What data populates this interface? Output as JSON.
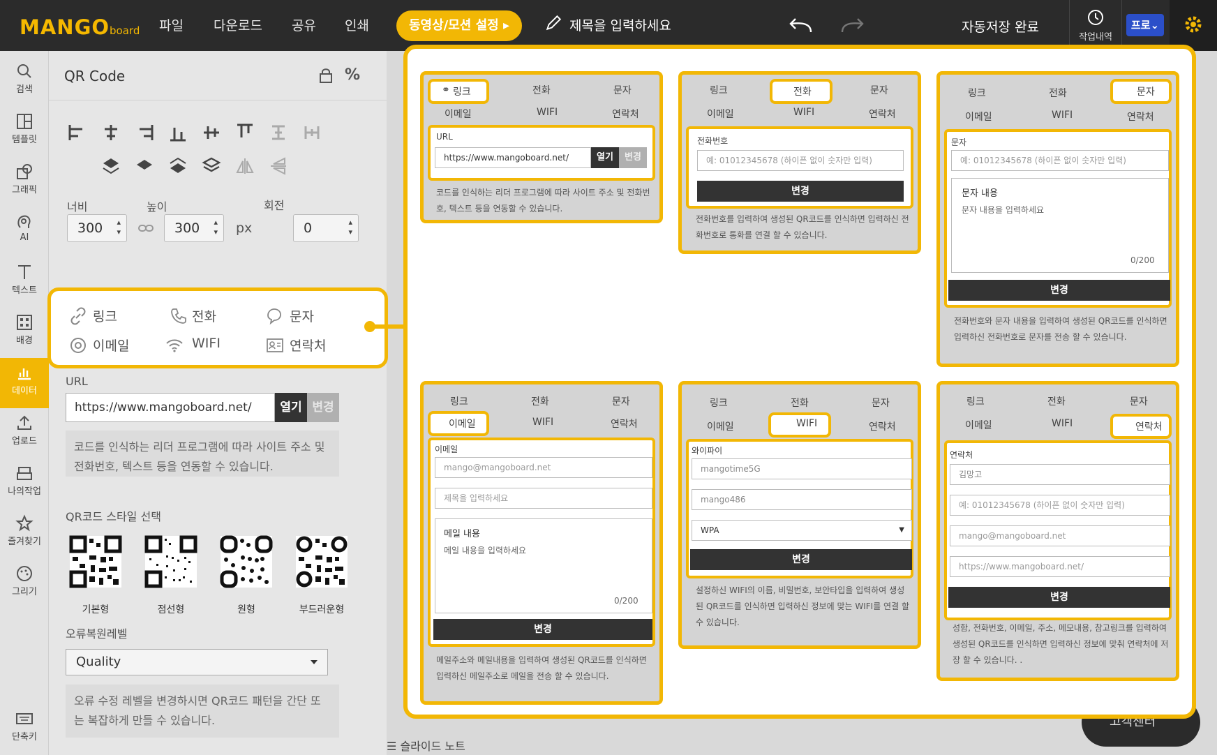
{
  "topbar": {
    "logo": "MANGO",
    "logo_small": "board",
    "menus": [
      "파일",
      "다운로드",
      "공유",
      "인쇄"
    ],
    "motion_button": "동영상/모션 설정 ▸",
    "title_placeholder": "제목을 입력하세요",
    "autosave": "자동저장 완료",
    "history": "작업내역",
    "pro": "프로⌄"
  },
  "iconbar": [
    "검색",
    "템플릿",
    "그래픽",
    "AI",
    "텍스트",
    "배경",
    "데이터",
    "업로드",
    "나의작업",
    "즐겨찾기",
    "그리기",
    "단축키"
  ],
  "panel": {
    "title": "QR Code",
    "width_label": "너비",
    "height_label": "높이",
    "rotate_label": "회전",
    "width": "300",
    "height": "300",
    "unit": "px",
    "rotate": "0",
    "tabs": [
      "링크",
      "전화",
      "문자",
      "이메일",
      "WIFI",
      "연락처"
    ],
    "url_label": "URL",
    "url_value": "https://www.mangoboard.net/",
    "open": "열기",
    "change": "변경",
    "desc": "코드를 인식하는 리더 프로그램에 따라 사이트 주소 및 전화번호, 텍스트 등을 연동할 수 있습니다.",
    "style_label": "QR코드 스타일 선택",
    "styles": [
      "기본형",
      "점선형",
      "원형",
      "부드러운형"
    ],
    "error_label": "오류복원레벨",
    "error_value": "Quality",
    "error_desc": "오류 수정 레벨을 변경하시면 QR코드 패턴을 간단 또는 복잡하게 만들 수 있습니다."
  },
  "slide_note": "슬라이드 노트",
  "help_bubble": "고객센터",
  "cards": {
    "link": {
      "label": "URL",
      "value": "https://www.mangoboard.net/",
      "open": "열기",
      "change": "변경",
      "desc": "코드를 인식하는 리더 프로그램에 따라 사이트 주소 및 전화번호, 텍스트 등을 연동할 수 있습니다."
    },
    "phone": {
      "label": "전화번호",
      "placeholder": "예: 01012345678 (하이픈 없이 숫자만 입력)",
      "button": "변경",
      "desc": "전화번호를 입력하여 생성된 QR코드를 인식하면 입력하신 전화번호로 통화를 연결 할 수 있습니다."
    },
    "sms": {
      "label": "문자",
      "placeholder": "예: 01012345678 (하이픈 없이 숫자만 입력)",
      "content_label": "문자 내용",
      "content_placeholder": "문자 내용을 입력하세요",
      "count": "0/200",
      "button": "변경",
      "desc": "전화번호와 문자 내용을 입력하여 생성된 QR코드를 인식하면 입력하신 전화번호로 문자를 전송 할 수 있습니다."
    },
    "email": {
      "label": "이메일",
      "email_placeholder": "mango@mangoboard.net",
      "subject_placeholder": "제목을 입력하세요",
      "content_label": "메일 내용",
      "content_placeholder": "메일 내용을 입력하세요",
      "count": "0/200",
      "button": "변경",
      "desc": "메일주소와 메일내용을 입력하여 생성된 QR코드를 인식하면 입력하신 메일주소로 메일을 전송 할 수 있습니다."
    },
    "wifi": {
      "label": "와이파이",
      "ssid": "mangotime5G",
      "password": "mango486",
      "security": "WPA",
      "button": "변경",
      "desc": "설정하신 WIFI의 이름, 비밀번호, 보안타입을 입력하여 생성된 QR코드를 인식하면 입력하신 정보에 맞는 WIFI를 연결 할 수 있습니다."
    },
    "contact": {
      "label": "연락처",
      "name": "김망고",
      "phone_placeholder": "예: 01012345678 (하이픈 없이 숫자만 입력)",
      "email": "mango@mangoboard.net",
      "url": "https://www.mangoboard.net/",
      "button": "변경",
      "desc": "성함, 전화번호, 이메일, 주소, 메모내용, 참고링크를 입력하여 생성된 QR코드를 인식하면 입력하신 정보에 맞춰 연락처에 저장 할 수 있습니다. ."
    }
  },
  "colors": {
    "accent": "#f2b705",
    "topbar": "#2b2b2b",
    "pro": "#2b4fc9"
  }
}
